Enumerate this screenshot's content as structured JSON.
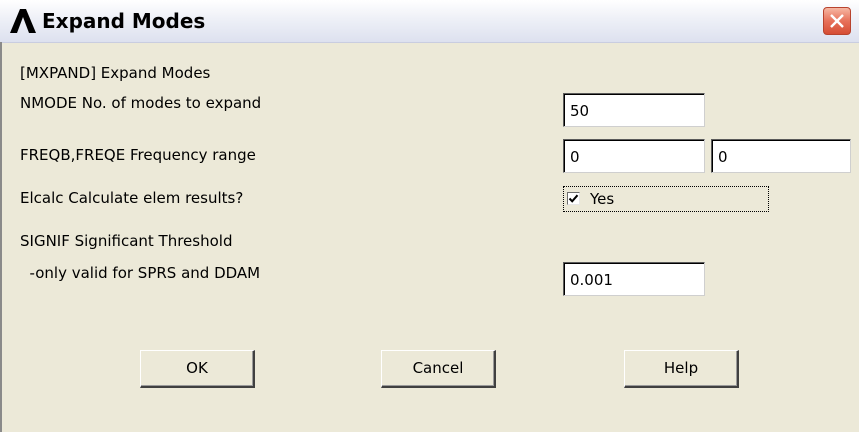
{
  "window": {
    "title": "Expand Modes",
    "close_icon": "close-icon",
    "logo_icon": "ansys-logo-icon"
  },
  "form": {
    "header": "[MXPAND]  Expand Modes",
    "nmode": {
      "label": "NMODE   No. of modes to expand",
      "value": "50"
    },
    "freq": {
      "label": "FREQB,FREQE   Frequency range",
      "value_begin": "0",
      "value_end": "0"
    },
    "elcalc": {
      "label": "Elcalc  Calculate elem results?",
      "checked": true,
      "checkbox_label": "Yes"
    },
    "signif": {
      "label": "SIGNIF Significant Threshold",
      "sublabel": "  -only valid for SPRS and DDAM",
      "value": "0.001"
    }
  },
  "buttons": {
    "ok": "OK",
    "cancel": "Cancel",
    "help": "Help"
  },
  "colors": {
    "dialog_bg": "#ece9d8",
    "close_red": "#d64d33"
  }
}
